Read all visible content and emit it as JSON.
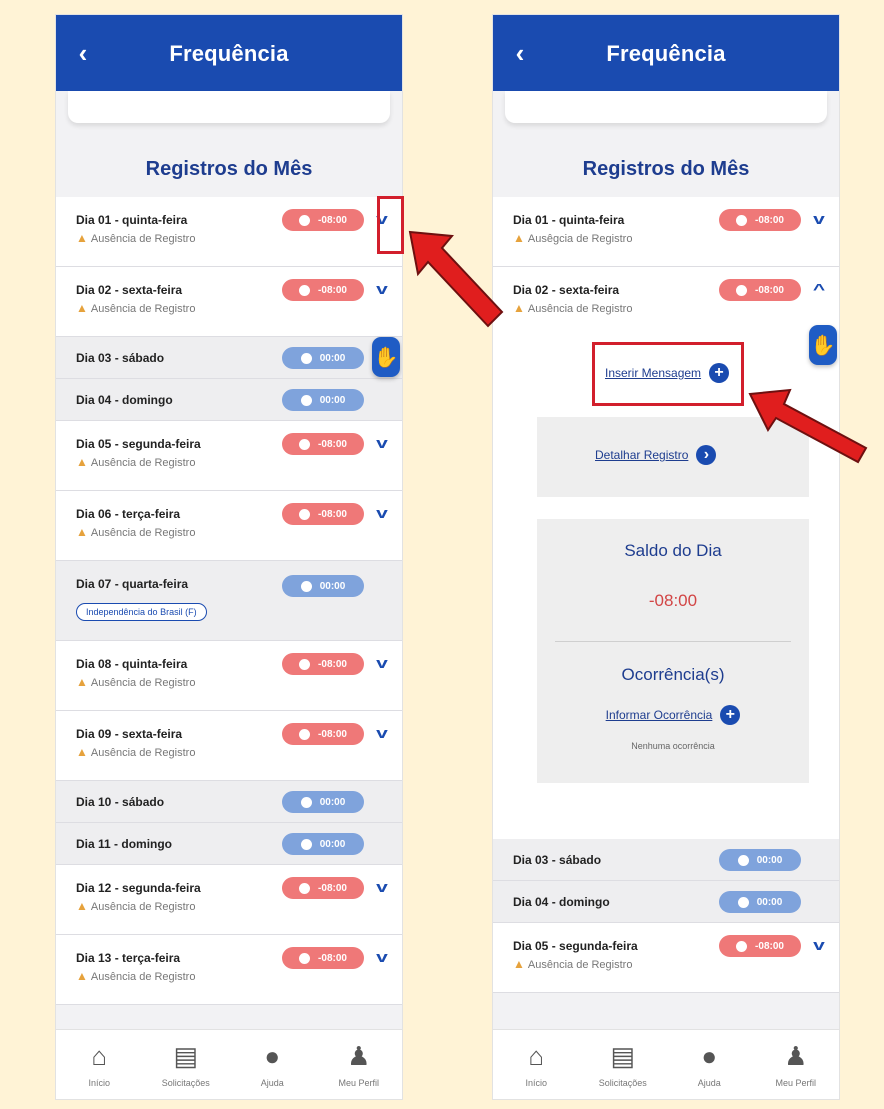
{
  "header": {
    "title": "Frequência",
    "back_icon": "‹"
  },
  "section_title": "Registros do Mês",
  "warning_text": "Ausência de Registro",
  "warning_text_typo": "Ausêgcia de Registro",
  "pill_red_value": "-08:00",
  "pill_blue_value": "00:00",
  "left_days": [
    {
      "label": "Dia 01 - quinta-feira",
      "kind": "absent"
    },
    {
      "label": "Dia 02 - sexta-feira",
      "kind": "absent"
    },
    {
      "label": "Dia 03 - sábado",
      "kind": "weekend"
    },
    {
      "label": "Dia 04 - domingo",
      "kind": "weekend"
    },
    {
      "label": "Dia 05 - segunda-feira",
      "kind": "absent"
    },
    {
      "label": "Dia 06 - terça-feira",
      "kind": "absent"
    },
    {
      "label": "Dia 07 - quarta-feira",
      "kind": "holiday",
      "tag": "Independência do Brasil (F)"
    },
    {
      "label": "Dia 08 - quinta-feira",
      "kind": "absent"
    },
    {
      "label": "Dia 09 - sexta-feira",
      "kind": "absent"
    },
    {
      "label": "Dia 10 - sábado",
      "kind": "weekend"
    },
    {
      "label": "Dia 11 - domingo",
      "kind": "weekend"
    },
    {
      "label": "Dia 12 - segunda-feira",
      "kind": "absent"
    },
    {
      "label": "Dia 13 - terça-feira",
      "kind": "absent"
    }
  ],
  "right": {
    "day1": "Dia 01 - quinta-feira",
    "day2": "Dia 02 - sexta-feira",
    "insert_message": "Inserir Mensagem",
    "detail_record": "Detalhar Registro",
    "saldo_title": "Saldo do Dia",
    "saldo_value": "-08:00",
    "ocorrencias_title": "Ocorrência(s)",
    "informar_ocorrencia": "Informar Ocorrência",
    "nenhuma": "Nenhuma ocorrência",
    "day3": "Dia 03 - sábado",
    "day4": "Dia 04 - domingo",
    "day5": "Dia 05 - segunda-feira"
  },
  "nav": [
    {
      "label": "Início",
      "icon": "home-icon"
    },
    {
      "label": "Solicitações",
      "icon": "clipboard-icon"
    },
    {
      "label": "Ajuda",
      "icon": "chat-icon"
    },
    {
      "label": "Meu Perfil",
      "icon": "user-icon"
    }
  ],
  "colors": {
    "header": "#1a4bb0",
    "pill_red": "#ef7878",
    "pill_blue": "#7fa3dc",
    "highlight": "#d21f2c",
    "background": "#fff3d6"
  }
}
